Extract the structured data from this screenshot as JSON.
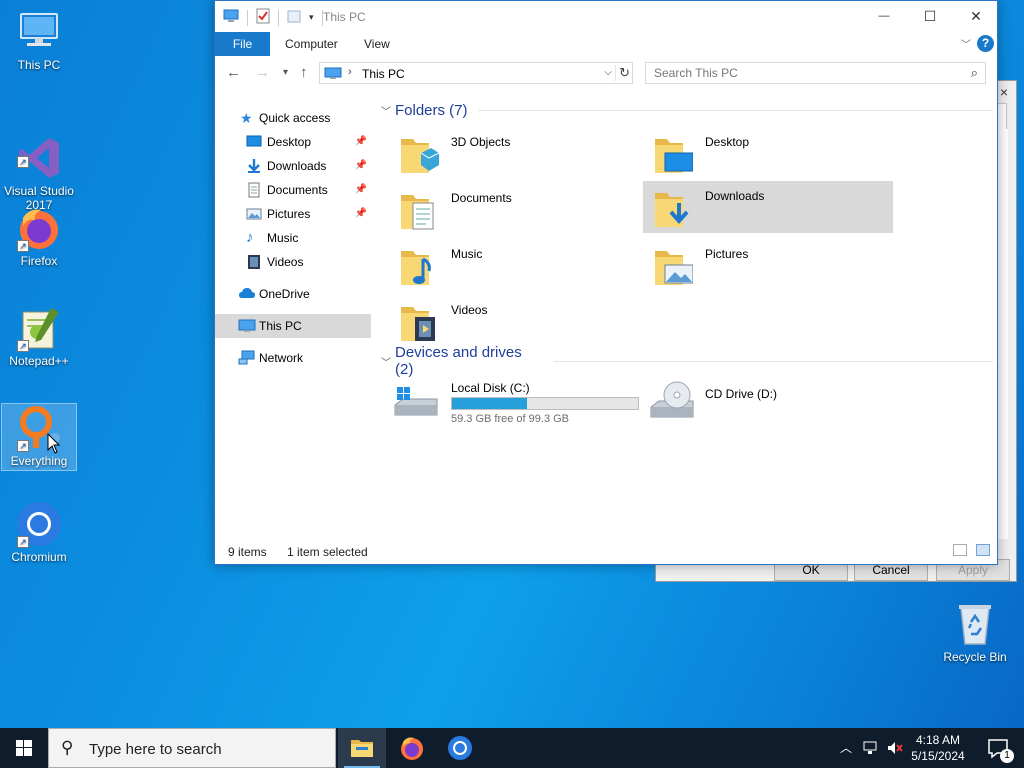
{
  "desktop": {
    "icons": [
      {
        "label": "This PC",
        "icon": "this-pc-icon"
      },
      {
        "label": "Visual Studio\n2017",
        "icon": "visual-studio-icon"
      },
      {
        "label": "Firefox",
        "icon": "firefox-icon"
      },
      {
        "label": "Notepad++",
        "icon": "notepad-plus-plus-icon"
      },
      {
        "label": "Everything",
        "icon": "everything-search-icon"
      },
      {
        "label": "Chromium",
        "icon": "chromium-icon"
      }
    ],
    "recycle_bin": {
      "label": "Recycle Bin"
    }
  },
  "background_dialog": {
    "close": "×",
    "buttons": [
      "OK",
      "Cancel",
      "Apply"
    ]
  },
  "explorer": {
    "title": "This PC",
    "window_buttons": {
      "minimize": "—",
      "maximize": "☐",
      "close": "✕"
    },
    "ribbon_tabs": [
      "File",
      "Computer",
      "View"
    ],
    "help": "?",
    "address": {
      "path": "This PC"
    },
    "search": {
      "placeholder": "Search This PC"
    },
    "navpane": {
      "quick_access": "Quick access",
      "pinned": [
        {
          "label": "Desktop",
          "pinned": true
        },
        {
          "label": "Downloads",
          "pinned": true
        },
        {
          "label": "Documents",
          "pinned": true
        },
        {
          "label": "Pictures",
          "pinned": true
        },
        {
          "label": "Music",
          "pinned": false
        },
        {
          "label": "Videos",
          "pinned": false
        }
      ],
      "onedrive": "OneDrive",
      "this_pc": "This PC",
      "network": "Network"
    },
    "folders_header": "Folders (7)",
    "folders": [
      {
        "name": "3D Objects",
        "icon": "3d-objects-folder-icon"
      },
      {
        "name": "Desktop",
        "icon": "desktop-folder-icon"
      },
      {
        "name": "Documents",
        "icon": "documents-folder-icon"
      },
      {
        "name": "Downloads",
        "icon": "downloads-folder-icon",
        "selected": true
      },
      {
        "name": "Music",
        "icon": "music-folder-icon"
      },
      {
        "name": "Pictures",
        "icon": "pictures-folder-icon"
      },
      {
        "name": "Videos",
        "icon": "videos-folder-icon"
      }
    ],
    "devices_header": "Devices and drives (2)",
    "drives": [
      {
        "name": "Local Disk (C:)",
        "free": "59.3 GB free of 99.3 GB",
        "used_fraction": 0.403,
        "icon": "local-disk-icon"
      },
      {
        "name": "CD Drive (D:)",
        "icon": "cd-drive-icon"
      }
    ],
    "status": {
      "items": "9 items",
      "selected": "1 item selected"
    }
  },
  "taskbar": {
    "search_placeholder": "Type here to search",
    "apps": [
      "file-explorer-icon",
      "firefox-icon",
      "chromium-icon"
    ],
    "clock": {
      "time": "4:18 AM",
      "date": "5/15/2024"
    },
    "notification_count": "1"
  },
  "colors": {
    "accent": "#1979ca",
    "selection": "#d9d9d9",
    "drive_bar": "#26a0da",
    "group_header": "#1e3f9a"
  }
}
